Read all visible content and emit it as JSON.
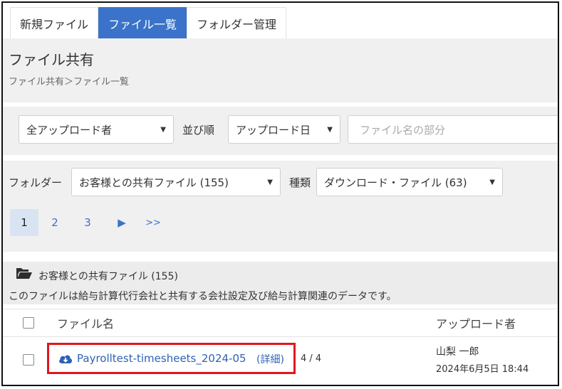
{
  "tabs": [
    {
      "label": "新規ファイル"
    },
    {
      "label": "ファイル一覧"
    },
    {
      "label": "フォルダー管理"
    }
  ],
  "page": {
    "title": "ファイル共有",
    "breadcrumb": "ファイル共有＞ファイル一覧"
  },
  "filters": {
    "uploader_value": "全アップロード者",
    "sort_label": "並び順",
    "sort_value": "アップロード日",
    "search_placeholder": "ファイル名の部分",
    "folder_label": "フォルダー",
    "folder_value": "お客様との共有ファイル (155)",
    "type_label": "種類",
    "type_value": "ダウンロード・ファイル (63)"
  },
  "pagination": {
    "pages": [
      "1",
      "2",
      "3"
    ],
    "next": "▶",
    "last": ">>"
  },
  "folder": {
    "name": "お客様との共有ファイル (155)",
    "description": "このファイルは給与計算代行会社と共有する会社設定及び給与計算関連のデータです。"
  },
  "table": {
    "headers": {
      "filename": "ファイル名",
      "uploader": "アップロード者"
    },
    "rows": [
      {
        "filename": "Payrolltest-timesheets_2024-05",
        "details": "(詳細)",
        "count": "4 / 4",
        "uploader": "山梨 一郎",
        "date": "2024年6月5日 18:44"
      }
    ]
  },
  "colors": {
    "accent": "#3a73c9",
    "highlight": "#e3151c"
  }
}
